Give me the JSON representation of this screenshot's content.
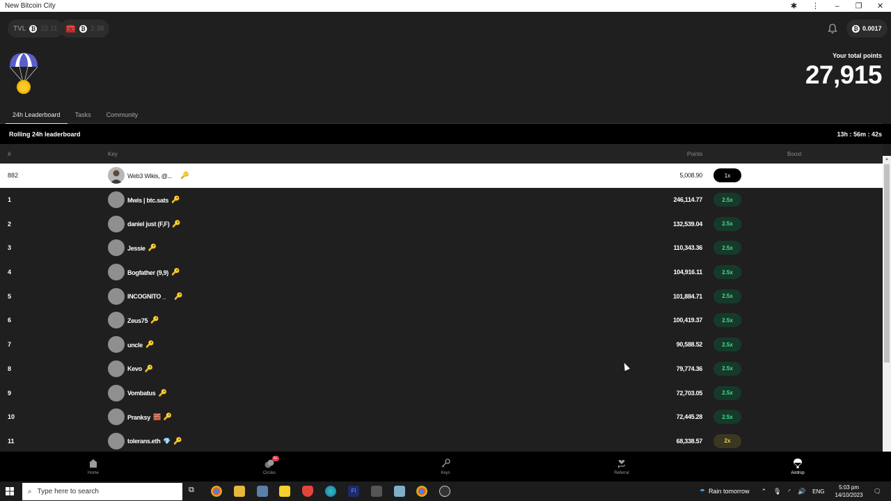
{
  "window": {
    "title": "New Bitcoin City",
    "controls": [
      "extensions-icon",
      "more-icon",
      "minimize",
      "restore",
      "close"
    ]
  },
  "header": {
    "tvl_label": "TVL",
    "tvl_value": "22.11",
    "treasure_value": "2.38",
    "balance": "0.0017",
    "total_points_label": "Your total points",
    "total_points": "27,915"
  },
  "tabs": [
    {
      "label": "24h Leaderboard",
      "active": true
    },
    {
      "label": "Tasks",
      "active": false
    },
    {
      "label": "Community",
      "active": false
    }
  ],
  "leaderboard": {
    "title": "Rolling 24h leaderboard",
    "countdown": "13h : 56m : 42s",
    "columns": {
      "rank": "#",
      "key": "Key",
      "points": "Points",
      "boost": "Boost"
    },
    "me": {
      "rank": "882",
      "name": "Web3 Wikis, @...",
      "points": "5,008.90",
      "boost": "1x"
    },
    "rows": [
      {
        "rank": "1",
        "name": "Mwis | btc.sats",
        "emoji": "",
        "points": "246,114.77",
        "boost": "2.5x"
      },
      {
        "rank": "2",
        "name": "daniel just (F,F)",
        "emoji": "",
        "points": "132,539.04",
        "boost": "2.5x"
      },
      {
        "rank": "3",
        "name": "Jessie",
        "emoji": "",
        "points": "110,343.36",
        "boost": "2.5x"
      },
      {
        "rank": "4",
        "name": "Bogfather (9,9)",
        "emoji": "",
        "points": "104,916.11",
        "boost": "2.5x"
      },
      {
        "rank": "5",
        "name": "INCOGNITO _",
        "emoji": "",
        "points": "101,884.71",
        "boost": "2.5x"
      },
      {
        "rank": "6",
        "name": "Zeus75",
        "emoji": "",
        "points": "100,419.37",
        "boost": "2.5x"
      },
      {
        "rank": "7",
        "name": "uncle",
        "emoji": "",
        "points": "90,588.52",
        "boost": "2.5x"
      },
      {
        "rank": "8",
        "name": "Kevo",
        "emoji": "",
        "points": "79,774.36",
        "boost": "2.5x"
      },
      {
        "rank": "9",
        "name": "Vombatus",
        "emoji": "",
        "points": "72,703.05",
        "boost": "2.5x"
      },
      {
        "rank": "10",
        "name": "Pranksy",
        "emoji": "🧱",
        "points": "72,445.28",
        "boost": "2.5x"
      },
      {
        "rank": "11",
        "name": "tolerans.eth",
        "emoji": "💎",
        "points": "68,338.57",
        "boost": "2x"
      }
    ]
  },
  "bottom_nav": [
    {
      "label": "Home",
      "icon": "home-icon",
      "active": false
    },
    {
      "label": "Circles",
      "icon": "circles-icon",
      "active": false,
      "badge": "9+"
    },
    {
      "label": "Keys",
      "icon": "key-icon",
      "active": false
    },
    {
      "label": "Referral",
      "icon": "referral-icon",
      "active": false
    },
    {
      "label": "Airdrop",
      "icon": "airdrop-icon",
      "active": true
    }
  ],
  "taskbar": {
    "search_placeholder": "Type here to search",
    "weather": "Rain tomorrow",
    "language": "ENG",
    "time": "5:03 pm",
    "date": "14/10/2023"
  },
  "colors": {
    "boost_green_bg": "#17392a",
    "boost_green_text": "#3ee08f",
    "boost_yellow_bg": "#3a3822",
    "boost_yellow_text": "#e6d64a",
    "key_gold": "#e0d35a",
    "notification_red": "#e0374d"
  }
}
